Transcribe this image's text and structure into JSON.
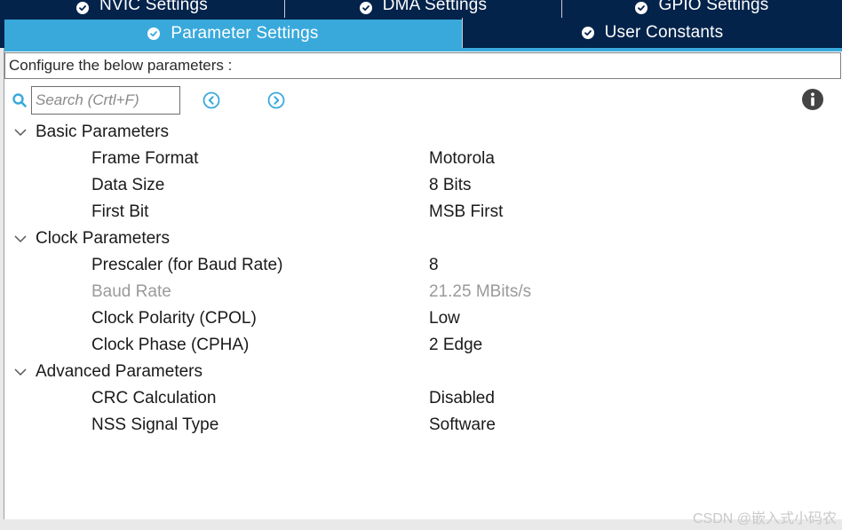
{
  "tabs_row1": [
    {
      "label": "NVIC Settings"
    },
    {
      "label": "DMA Settings"
    },
    {
      "label": "GPIO Settings"
    }
  ],
  "tabs_row2": [
    {
      "label": "Parameter Settings",
      "active": true
    },
    {
      "label": "User Constants",
      "active": false
    }
  ],
  "configure_text": "Configure the below parameters :",
  "search": {
    "placeholder": "Search (Crtl+F)",
    "value": ""
  },
  "toolbar": {
    "prev_icon": "circle-chevron-left-icon",
    "next_icon": "circle-chevron-right-icon",
    "info_icon": "info-icon"
  },
  "groups": [
    {
      "label": "Basic Parameters",
      "params": [
        {
          "name": "Frame Format",
          "value": "Motorola"
        },
        {
          "name": "Data Size",
          "value": "8 Bits"
        },
        {
          "name": "First Bit",
          "value": "MSB First"
        }
      ]
    },
    {
      "label": "Clock Parameters",
      "params": [
        {
          "name": "Prescaler (for Baud Rate)",
          "value": "8"
        },
        {
          "name": "Baud Rate",
          "value": "21.25 MBits/s",
          "disabled": true
        },
        {
          "name": "Clock Polarity (CPOL)",
          "value": "Low"
        },
        {
          "name": "Clock Phase (CPHA)",
          "value": "2 Edge"
        }
      ]
    },
    {
      "label": "Advanced Parameters",
      "params": [
        {
          "name": "CRC Calculation",
          "value": "Disabled"
        },
        {
          "name": "NSS Signal Type",
          "value": "Software"
        }
      ]
    }
  ],
  "watermark": "CSDN @嵌入式小码农",
  "colors": {
    "tab_dark": "#03234b",
    "tab_active": "#39a9dc",
    "disabled_text": "#9a9a9a"
  }
}
